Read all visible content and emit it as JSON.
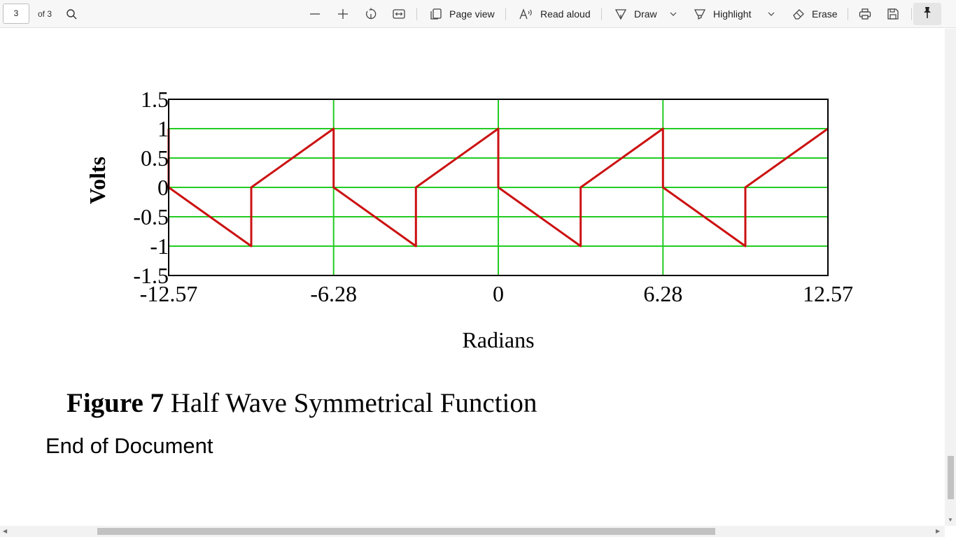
{
  "toolbar": {
    "page_number": "3",
    "page_total_label": "of 3",
    "page_view_label": "Page view",
    "read_aloud_label": "Read aloud",
    "draw_label": "Draw",
    "highlight_label": "Highlight",
    "erase_label": "Erase",
    "colors": {
      "background": "#f7f7f7",
      "pin_active": "#e6e6e6"
    }
  },
  "document": {
    "figure_caption_bold": "Figure 7",
    "figure_caption_text": " Half Wave Symmetrical Function",
    "end_text": "End of Document"
  },
  "chart_data": {
    "type": "line",
    "title": "",
    "xlabel": "Radians",
    "ylabel": "Volts",
    "xlim": [
      -12.57,
      12.57
    ],
    "ylim": [
      -1.5,
      1.5
    ],
    "x_ticks": [
      "-12.57",
      "-6.28",
      "0",
      "6.28",
      "12.57"
    ],
    "y_ticks": [
      "1.5",
      "1",
      "0.5",
      "0",
      "-0.5",
      "-1",
      "-1.5"
    ],
    "grid": true,
    "grid_color": "#22cc22",
    "line_color": "#cc1111",
    "series": [
      {
        "x": [
          -12.57,
          -12.57,
          -9.42,
          -9.42,
          -6.28,
          -6.28,
          -3.14,
          -3.14,
          0,
          0,
          3.14,
          3.14,
          6.28,
          6.28,
          9.42,
          9.42,
          12.57
        ],
        "y": [
          1,
          0,
          -1,
          0,
          1,
          0,
          -1,
          0,
          1,
          0,
          -1,
          0,
          1,
          0,
          -1,
          0,
          1
        ]
      }
    ]
  },
  "scrollbars": {
    "vertical_position": 0.95,
    "horizontal_position": 0.1
  }
}
